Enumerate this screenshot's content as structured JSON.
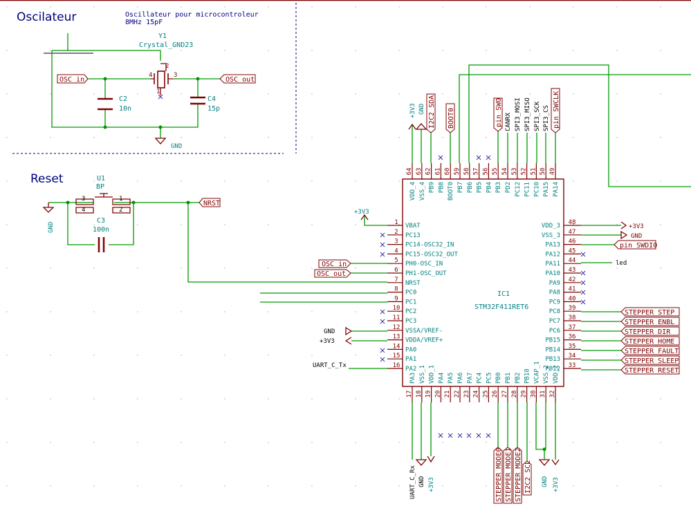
{
  "sections": {
    "osc": "Oscilateur",
    "reset": "Reset"
  },
  "osc_note": {
    "line1": "Oscillateur pour microcontroleur",
    "line2": "8MHz 15pF"
  },
  "y1": {
    "ref": "Y1",
    "value": "Crystal_GND23",
    "p4": "4",
    "p2": "2",
    "p3": "3",
    "p1": "1"
  },
  "c2": {
    "ref": "C2",
    "value": "10n"
  },
  "c4": {
    "ref": "C4",
    "value": "15p"
  },
  "c3": {
    "ref": "C3",
    "value": "100n"
  },
  "u1": {
    "ref": "U1",
    "value": "BP",
    "p3": "3",
    "p4": "4",
    "p1": "1",
    "p2": "2"
  },
  "labels": {
    "osc_in": "OSC_in",
    "osc_out": "OSC_out",
    "nrst": "NRST",
    "i2c_sda": "I2C2_SDA",
    "boot0": "BOOT0",
    "pin_swo": "pin_SWO",
    "pin_swclk": "pin_SWCLK",
    "pin_swdio": "pin_SWDIO",
    "i2c_scl": "I2C2_SCL"
  },
  "power": {
    "gnd": "GND",
    "v33": "+3V3"
  },
  "uart": {
    "tx": "UART_C_Tx",
    "rx": "UART_C_Rx"
  },
  "led": "led",
  "ic": {
    "ref": "IC1",
    "value": "STM32F411RET6"
  },
  "left_pins": [
    {
      "num": "1",
      "name": "VBAT"
    },
    {
      "num": "2",
      "name": "PC13"
    },
    {
      "num": "3",
      "name": "PC14-OSC32_IN"
    },
    {
      "num": "4",
      "name": "PC15-OSC32_OUT"
    },
    {
      "num": "5",
      "name": "PH0-OSC_IN"
    },
    {
      "num": "6",
      "name": "PH1-OSC_OUT"
    },
    {
      "num": "7",
      "name": "NRST"
    },
    {
      "num": "8",
      "name": "PC0"
    },
    {
      "num": "9",
      "name": "PC1"
    },
    {
      "num": "10",
      "name": "PC2"
    },
    {
      "num": "11",
      "name": "PC3"
    },
    {
      "num": "12",
      "name": "VSSA/VREF-"
    },
    {
      "num": "13",
      "name": "VDDA/VREF+"
    },
    {
      "num": "14",
      "name": "PA0"
    },
    {
      "num": "15",
      "name": "PA1"
    },
    {
      "num": "16",
      "name": "PA2"
    }
  ],
  "right_pins": [
    {
      "num": "48",
      "name": "VDD_3"
    },
    {
      "num": "47",
      "name": "VSS_3"
    },
    {
      "num": "46",
      "name": "PA13"
    },
    {
      "num": "45",
      "name": "PA12"
    },
    {
      "num": "44",
      "name": "PA11"
    },
    {
      "num": "43",
      "name": "PA10"
    },
    {
      "num": "42",
      "name": "PA9"
    },
    {
      "num": "41",
      "name": "PA8"
    },
    {
      "num": "40",
      "name": "PC9"
    },
    {
      "num": "39",
      "name": "PC8"
    },
    {
      "num": "38",
      "name": "PC7"
    },
    {
      "num": "37",
      "name": "PC6"
    },
    {
      "num": "36",
      "name": "PB15"
    },
    {
      "num": "35",
      "name": "PB14"
    },
    {
      "num": "34",
      "name": "PB13"
    },
    {
      "num": "33",
      "name": "PB12"
    }
  ],
  "top_pins": [
    {
      "num": "64",
      "name": "VDD_4"
    },
    {
      "num": "63",
      "name": "VSS_4"
    },
    {
      "num": "62",
      "name": "PB9"
    },
    {
      "num": "61",
      "name": "PB8"
    },
    {
      "num": "60",
      "name": "BOOT0"
    },
    {
      "num": "59",
      "name": "PB7"
    },
    {
      "num": "58",
      "name": "PB6"
    },
    {
      "num": "57",
      "name": "PB5"
    },
    {
      "num": "56",
      "name": "PB4"
    },
    {
      "num": "55",
      "name": "PB3"
    },
    {
      "num": "54",
      "name": "PD2"
    },
    {
      "num": "53",
      "name": "PC12"
    },
    {
      "num": "52",
      "name": "PC11"
    },
    {
      "num": "51",
      "name": "PC10"
    },
    {
      "num": "50",
      "name": "PA15"
    },
    {
      "num": "49",
      "name": "PA14"
    }
  ],
  "bottom_pins": [
    {
      "num": "17",
      "name": "PA3"
    },
    {
      "num": "18",
      "name": "VSS_1"
    },
    {
      "num": "19",
      "name": "VDD_1"
    },
    {
      "num": "20",
      "name": "PA4"
    },
    {
      "num": "21",
      "name": "PA5"
    },
    {
      "num": "22",
      "name": "PA6"
    },
    {
      "num": "23",
      "name": "PA7"
    },
    {
      "num": "24",
      "name": "PC4"
    },
    {
      "num": "25",
      "name": "PC5"
    },
    {
      "num": "26",
      "name": "PB0"
    },
    {
      "num": "27",
      "name": "PB1"
    },
    {
      "num": "28",
      "name": "PB2"
    },
    {
      "num": "29",
      "name": "PB10"
    },
    {
      "num": "30",
      "name": "VCAP_1"
    },
    {
      "num": "31",
      "name": "VSS_2"
    },
    {
      "num": "32",
      "name": "VDD_2"
    }
  ],
  "top_nets": [
    "CANRX",
    "SPI3_MOSI",
    "SPI3_MISO",
    "SPI3_SCK",
    "SPI3_CS"
  ],
  "stepper_right": [
    "STEPPER_STEP",
    "STEPPER_ENBL",
    "STEPPER_DIR",
    "STEPPER_HOME",
    "STEPPER_FAULT",
    "STEPPER_SLEEP",
    "STEPPER_RESET"
  ],
  "stepper_bottom": [
    "STEPPER_MODE0",
    "STEPPER_MODE1",
    "STEPPER_MODE2"
  ]
}
